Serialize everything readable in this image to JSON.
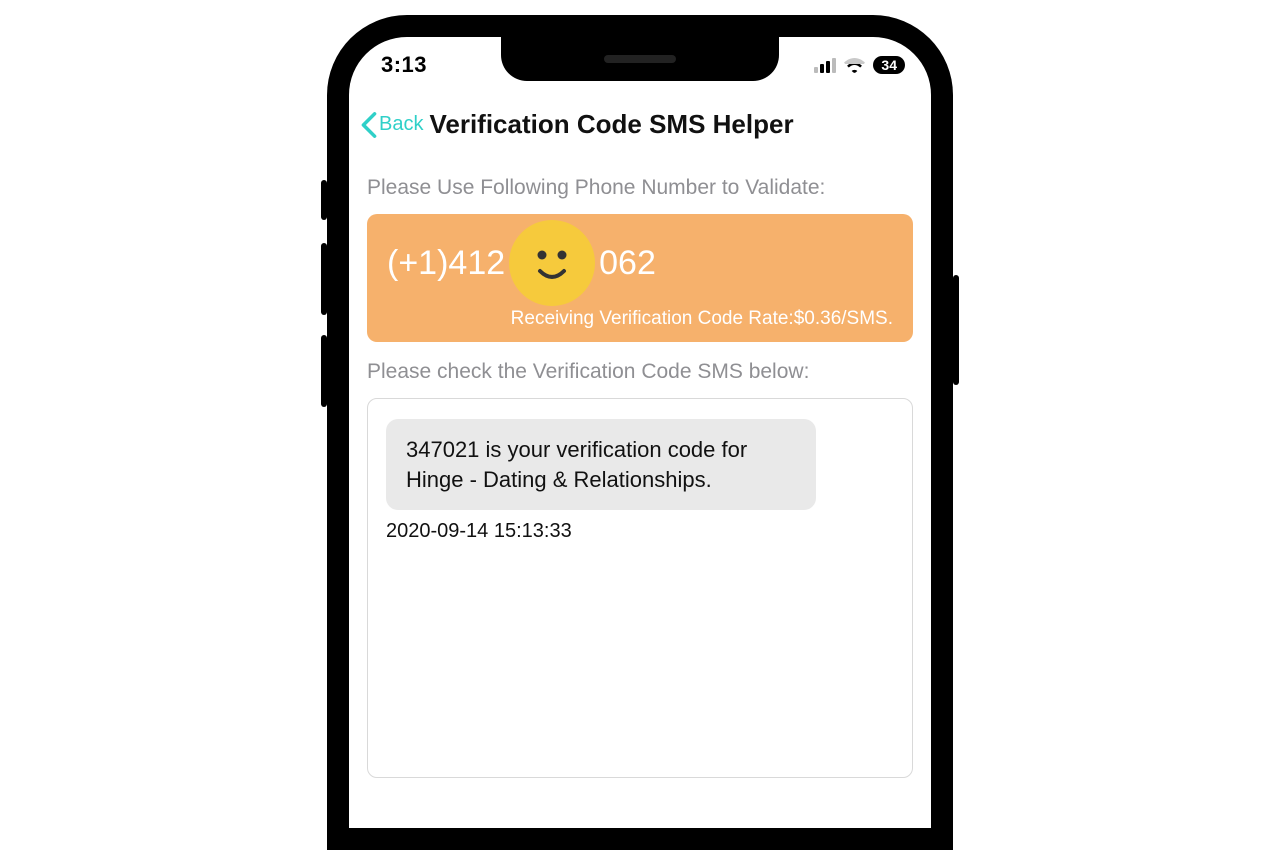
{
  "statusbar": {
    "time": "3:13",
    "battery": "34"
  },
  "nav": {
    "back_label": "Back",
    "title": "Verification Code SMS Helper"
  },
  "instructions": {
    "use_number": "Please Use Following Phone Number to Validate:",
    "check_sms": "Please check the Verification Code SMS below:"
  },
  "number_card": {
    "prefix": "(+1)412",
    "suffix": "062",
    "rate": "Receiving Verification Code Rate:$0.36/SMS."
  },
  "sms": {
    "body": "347021 is your verification code for Hinge - Dating & Relationships.",
    "timestamp": "2020-09-14 15:13:33"
  }
}
